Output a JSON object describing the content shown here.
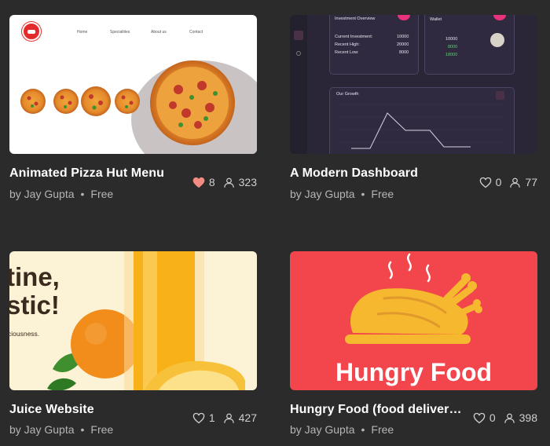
{
  "cards": [
    {
      "title": "Animated Pizza Hut Menu",
      "author": "by Jay Gupta",
      "price": "Free",
      "likes": "8",
      "liked": true,
      "views": "323",
      "preview": {
        "nav": [
          "Home",
          "Specialities",
          "About us",
          "Contact"
        ]
      }
    },
    {
      "title": "A Modern Dashboard",
      "author": "by Jay Gupta",
      "price": "Free",
      "likes": "0",
      "liked": false,
      "views": "77",
      "preview": {
        "investment_title": "Investment Overview",
        "current_label": "Current Investment:",
        "current_value": "10000",
        "high_label": "Recent High:",
        "high_value": "20000",
        "low_label": "Recent Low:",
        "low_value": "8000",
        "wallet_title": "Wallet",
        "wallet_values": [
          "10000",
          "8000",
          "18000"
        ],
        "growth_title": "Our Growth"
      }
    },
    {
      "title": "Juice Website",
      "author": "by Jay Gupta",
      "price": "Free",
      "likes": "1",
      "liked": false,
      "views": "427",
      "preview": {
        "line1": "tine,",
        "line2": "stic!",
        "line3": "ciousness."
      }
    },
    {
      "title": "Hungry Food (food deliver…",
      "author": "by Jay Gupta",
      "price": "Free",
      "likes": "0",
      "liked": false,
      "views": "398",
      "preview": {
        "headline": "Hungry Food"
      }
    }
  ],
  "colors": {
    "background": "#2b2b2b",
    "liked_heart": "#f28b82",
    "pizza_red": "#e32b2b",
    "dashboard_bg": "#2a2638",
    "dashboard_accent": "#e8327a",
    "hungry_red": "#f2454c",
    "chicken_yellow": "#f5b82e"
  },
  "icons": {
    "like": "heart-icon",
    "views": "person-icon"
  }
}
